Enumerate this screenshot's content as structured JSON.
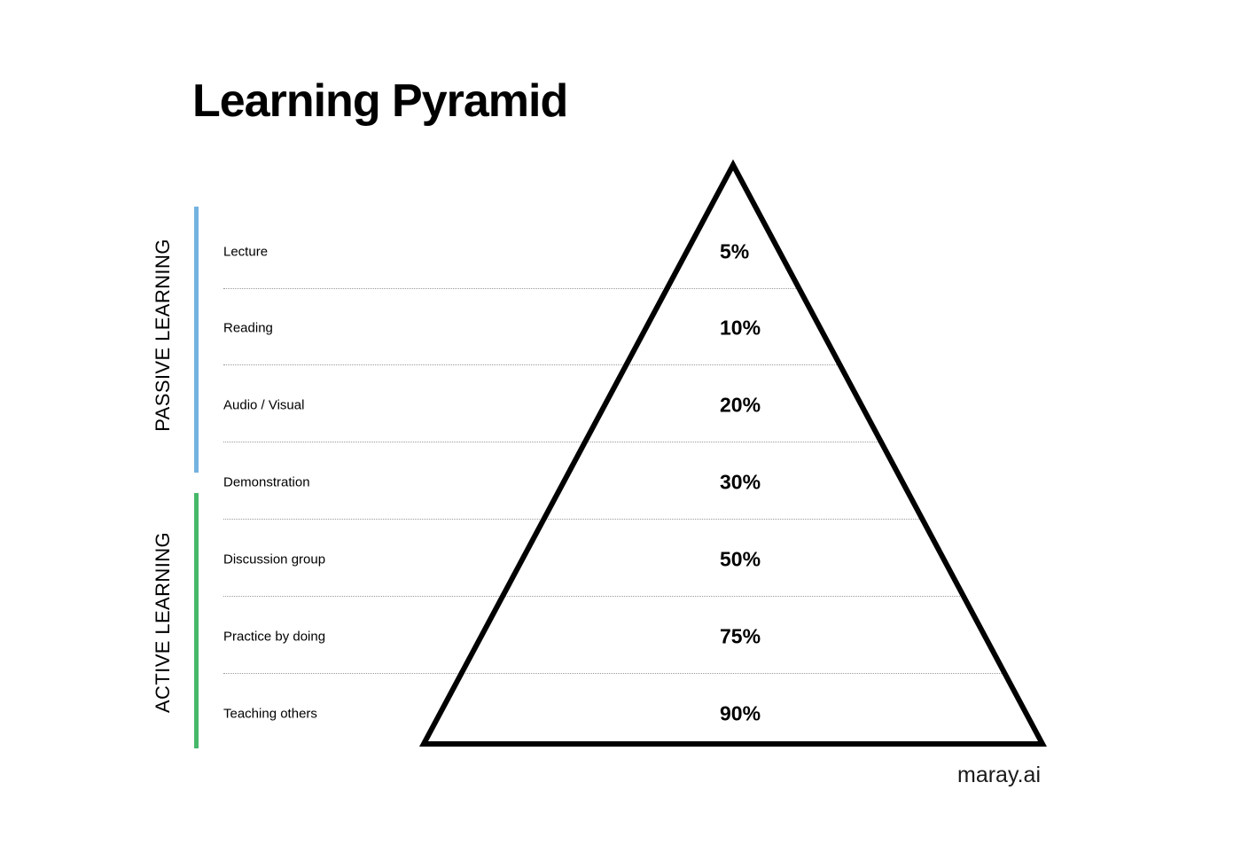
{
  "title": "Learning Pyramid",
  "groups": [
    {
      "label": "PASSIVE LEARNING",
      "color": "#74b3e0"
    },
    {
      "label": "ACTIVE LEARNING",
      "color": "#47b86a"
    }
  ],
  "levels": [
    {
      "label": "Lecture",
      "percent": "5%"
    },
    {
      "label": "Reading",
      "percent": "10%"
    },
    {
      "label": "Audio / Visual",
      "percent": "20%"
    },
    {
      "label": "Demonstration",
      "percent": "30%"
    },
    {
      "label": "Discussion group",
      "percent": "50%"
    },
    {
      "label": "Practice by doing",
      "percent": "75%"
    },
    {
      "label": "Teaching others",
      "percent": "90%"
    }
  ],
  "brand": "maray.ai"
}
